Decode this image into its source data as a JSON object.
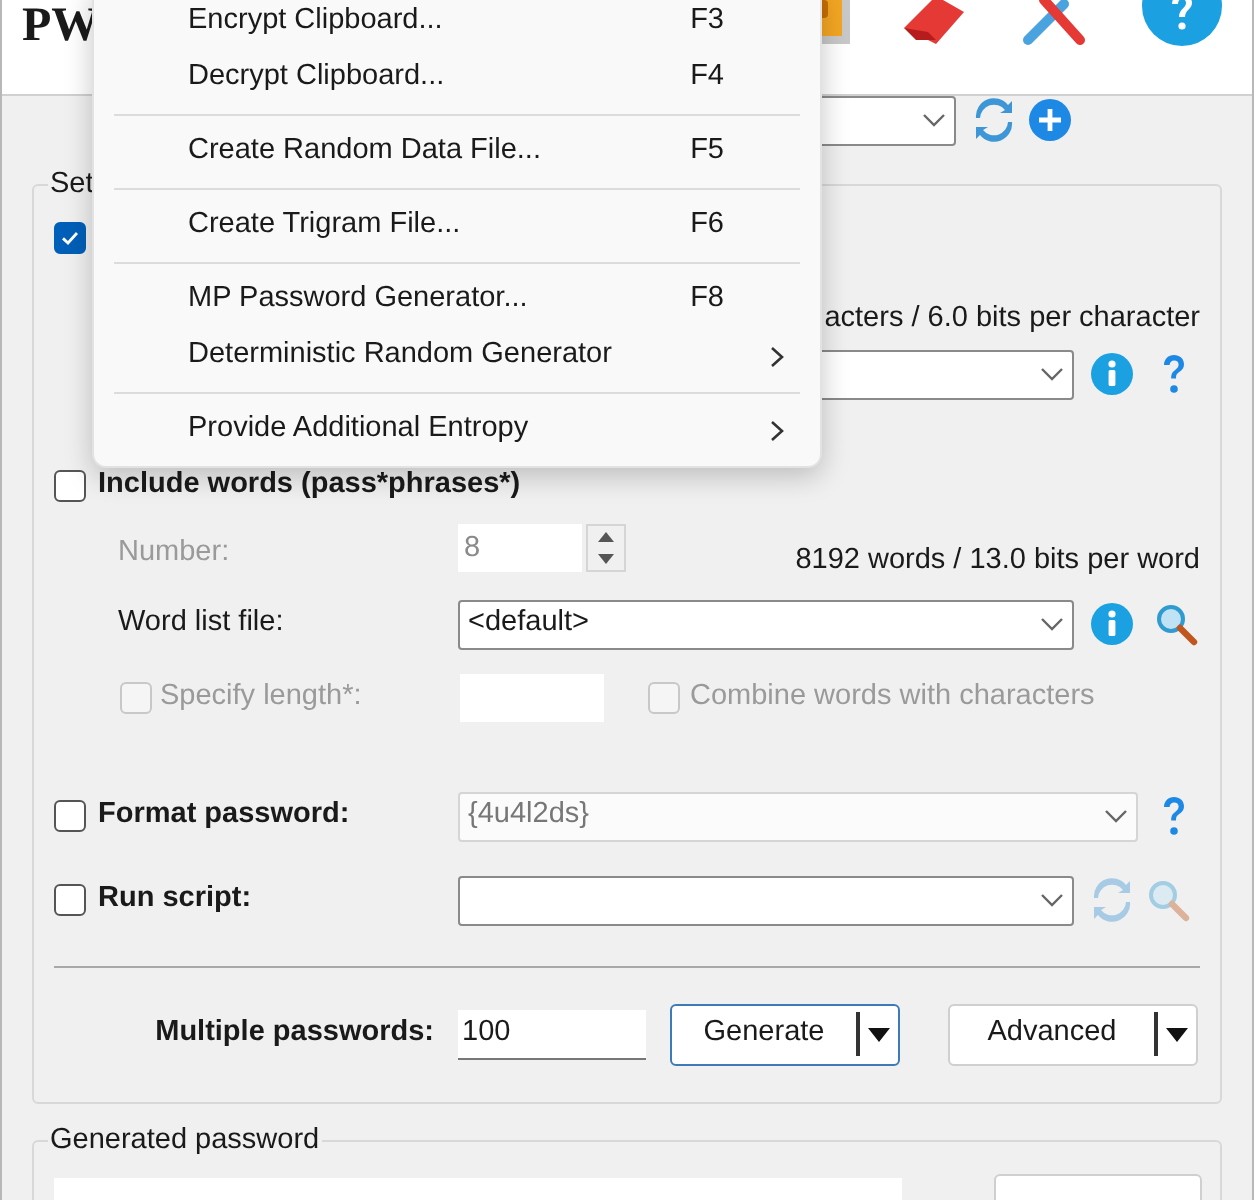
{
  "app_title": "PW",
  "menu": {
    "items": [
      {
        "kind": "item",
        "label": "Encrypt Clipboard...",
        "shortcut": "F3"
      },
      {
        "kind": "item",
        "label": "Decrypt Clipboard...",
        "shortcut": "F4"
      },
      {
        "kind": "separator"
      },
      {
        "kind": "item",
        "label": "Create Random Data File...",
        "shortcut": "F5"
      },
      {
        "kind": "separator"
      },
      {
        "kind": "item",
        "label": "Create Trigram File...",
        "shortcut": "F6"
      },
      {
        "kind": "separator"
      },
      {
        "kind": "item",
        "label": "MP Password Generator...",
        "shortcut": "F8"
      },
      {
        "kind": "submenu",
        "label": "Deterministic Random Generator"
      },
      {
        "kind": "separator"
      },
      {
        "kind": "submenu",
        "label": "Provide Additional Entropy"
      }
    ]
  },
  "settings": {
    "label": "Set",
    "include_chars_checked": true,
    "char_info": "acters / 6.0 bits per character"
  },
  "words": {
    "label": "Include words (pass*phrases*)",
    "checked": false,
    "number_label": "Number:",
    "number_value": "8",
    "info": "8192 words / 13.0 bits per word",
    "word_list_label": "Word list file:",
    "word_list_value": "<default>",
    "specify_length": {
      "label": "Specify length*:",
      "checked": false
    },
    "combine": {
      "label": "Combine words with characters",
      "checked": false
    }
  },
  "format": {
    "label": "Format password:",
    "checked": false,
    "value": "{4u4l2ds}"
  },
  "script": {
    "label": "Run script:",
    "checked": false
  },
  "multiple": {
    "label": "Multiple passwords:",
    "value": "100"
  },
  "buttons": [
    {
      "label": "Generate",
      "focused": true
    },
    {
      "label": "Advanced",
      "focused": false
    }
  ],
  "generated": {
    "label": "Generated password"
  }
}
